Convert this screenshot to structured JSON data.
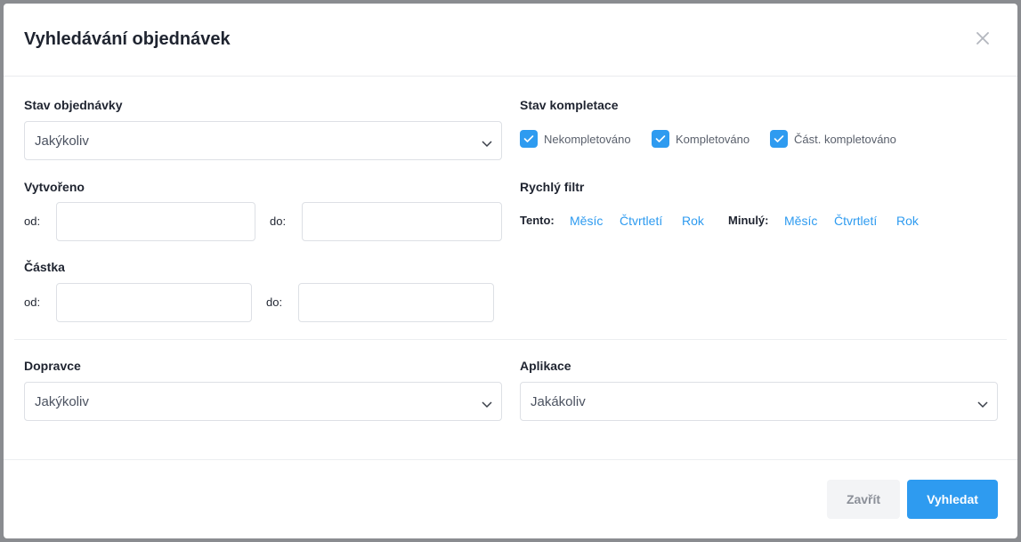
{
  "dialog": {
    "title": "Vyhledávání objednávek"
  },
  "order_status": {
    "label": "Stav objednávky",
    "value": "Jakýkoliv"
  },
  "completion_status": {
    "label": "Stav kompletace",
    "options": [
      {
        "label": "Nekompletováno",
        "checked": true
      },
      {
        "label": "Kompletováno",
        "checked": true
      },
      {
        "label": "Část. kompletováno",
        "checked": true
      }
    ]
  },
  "created": {
    "label": "Vytvořeno",
    "from_label": "od:",
    "to_label": "do:",
    "from_value": "",
    "to_value": ""
  },
  "quick_filter": {
    "label": "Rychlý filtr",
    "this_label": "Tento:",
    "last_label": "Minulý:",
    "this_links": [
      "Měsíc",
      "Čtvrtletí",
      "Rok"
    ],
    "last_links": [
      "Měsíc",
      "Čtvrtletí",
      "Rok"
    ]
  },
  "amount": {
    "label": "Částka",
    "from_label": "od:",
    "to_label": "do:",
    "from_value": "",
    "to_value": ""
  },
  "carrier": {
    "label": "Dopravce",
    "value": "Jakýkoliv"
  },
  "application": {
    "label": "Aplikace",
    "value": "Jakákoliv"
  },
  "footer": {
    "close_label": "Zavřít",
    "search_label": "Vyhledat"
  },
  "colors": {
    "accent": "#2e9bf0",
    "text": "#1f2430",
    "border": "#dde0e5"
  }
}
